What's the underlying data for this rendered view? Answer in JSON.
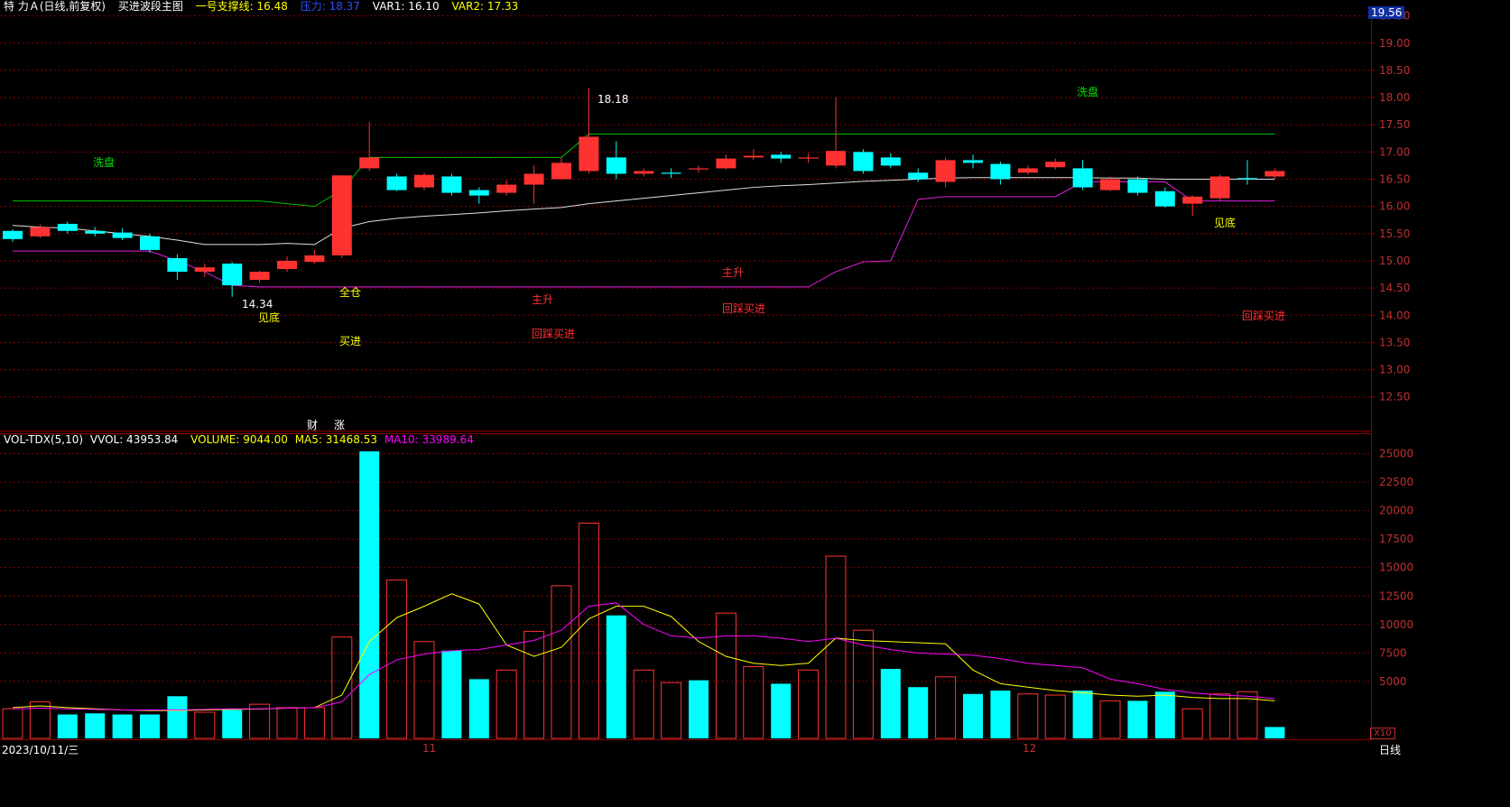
{
  "header": {
    "stock_name": "特 力Ａ(日线,前复权)",
    "indicator_name": "买进波段主图",
    "support_label": "一号支撑线: 16.48",
    "resistance_label": "压力: 18.37",
    "var1_label": "VAR1: 16.10",
    "var2_label": "VAR2: 17.33",
    "price_tag": "19.56"
  },
  "volume_header": {
    "name": "VOL-TDX(5,10)",
    "vvol": "VVOL: 43953.84",
    "volume": "VOLUME: 9044.00",
    "ma5": "MA5: 31468.53",
    "ma10": "MA10: 33989.64"
  },
  "footer": {
    "date": "2023/10/11/三",
    "month_nov": "11",
    "month_dec": "12",
    "period": "日线",
    "zoom": "X10"
  },
  "colors": {
    "up": "#ff3232",
    "down": "#00ffff",
    "volma5": "#ffff00",
    "volma10": "#ff00ff",
    "grid": "#8b0000",
    "support": "#00c000",
    "white_line": "#e0e0e0",
    "lower_band": "#e020e0"
  },
  "chart_data": [
    {
      "type": "candlestick",
      "title": "",
      "ylim": [
        12.0,
        19.56
      ],
      "yticks": [
        "19.50",
        "19.00",
        "18.50",
        "18.00",
        "17.50",
        "17.00",
        "16.50",
        "16.00",
        "15.50",
        "15.00",
        "14.50",
        "14.00",
        "13.50",
        "13.00",
        "12.50"
      ],
      "candles": [
        {
          "o": 15.55,
          "c": 15.4,
          "h": 15.58,
          "l": 15.35
        },
        {
          "o": 15.45,
          "c": 15.62,
          "h": 15.67,
          "l": 15.42
        },
        {
          "o": 15.68,
          "c": 15.55,
          "h": 15.72,
          "l": 15.5
        },
        {
          "o": 15.55,
          "c": 15.5,
          "h": 15.62,
          "l": 15.45
        },
        {
          "o": 15.52,
          "c": 15.42,
          "h": 15.6,
          "l": 15.38
        },
        {
          "o": 15.45,
          "c": 15.2,
          "h": 15.5,
          "l": 15.15
        },
        {
          "o": 15.05,
          "c": 14.8,
          "h": 15.12,
          "l": 14.65
        },
        {
          "o": 14.8,
          "c": 14.88,
          "h": 14.95,
          "l": 14.7
        },
        {
          "o": 14.95,
          "c": 14.55,
          "h": 14.98,
          "l": 14.34
        },
        {
          "o": 14.65,
          "c": 14.8,
          "h": 14.82,
          "l": 14.6
        },
        {
          "o": 14.85,
          "c": 15.0,
          "h": 15.08,
          "l": 14.8
        },
        {
          "o": 14.98,
          "c": 15.1,
          "h": 15.2,
          "l": 14.95
        },
        {
          "o": 15.1,
          "c": 16.57,
          "h": 16.57,
          "l": 15.05
        },
        {
          "o": 16.7,
          "c": 16.9,
          "h": 17.55,
          "l": 16.65
        },
        {
          "o": 16.55,
          "c": 16.3,
          "h": 16.6,
          "l": 16.28
        },
        {
          "o": 16.35,
          "c": 16.58,
          "h": 16.62,
          "l": 16.3
        },
        {
          "o": 16.55,
          "c": 16.25,
          "h": 16.6,
          "l": 16.2
        },
        {
          "o": 16.3,
          "c": 16.2,
          "h": 16.35,
          "l": 16.05
        },
        {
          "o": 16.25,
          "c": 16.4,
          "h": 16.48,
          "l": 16.2
        },
        {
          "o": 16.4,
          "c": 16.6,
          "h": 16.75,
          "l": 16.05
        },
        {
          "o": 16.5,
          "c": 16.8,
          "h": 16.9,
          "l": 16.5
        },
        {
          "o": 16.65,
          "c": 17.28,
          "h": 18.18,
          "l": 16.6
        },
        {
          "o": 16.9,
          "c": 16.6,
          "h": 17.2,
          "l": 16.5
        },
        {
          "o": 16.6,
          "c": 16.65,
          "h": 16.7,
          "l": 16.55
        },
        {
          "o": 16.62,
          "c": 16.6,
          "h": 16.7,
          "l": 16.52
        },
        {
          "o": 16.68,
          "c": 16.7,
          "h": 16.75,
          "l": 16.62
        },
        {
          "o": 16.7,
          "c": 16.88,
          "h": 16.95,
          "l": 16.68
        },
        {
          "o": 16.9,
          "c": 16.93,
          "h": 17.05,
          "l": 16.85
        },
        {
          "o": 16.95,
          "c": 16.88,
          "h": 17.0,
          "l": 16.8
        },
        {
          "o": 16.88,
          "c": 16.9,
          "h": 16.97,
          "l": 16.8
        },
        {
          "o": 16.75,
          "c": 17.02,
          "h": 18.0,
          "l": 16.7
        },
        {
          "o": 17.0,
          "c": 16.65,
          "h": 17.05,
          "l": 16.6
        },
        {
          "o": 16.9,
          "c": 16.75,
          "h": 16.98,
          "l": 16.7
        },
        {
          "o": 16.62,
          "c": 16.5,
          "h": 16.7,
          "l": 16.45
        },
        {
          "o": 16.45,
          "c": 16.85,
          "h": 16.9,
          "l": 16.35
        },
        {
          "o": 16.85,
          "c": 16.8,
          "h": 16.95,
          "l": 16.7
        },
        {
          "o": 16.78,
          "c": 16.5,
          "h": 16.82,
          "l": 16.4
        },
        {
          "o": 16.62,
          "c": 16.7,
          "h": 16.75,
          "l": 16.58
        },
        {
          "o": 16.72,
          "c": 16.82,
          "h": 16.88,
          "l": 16.68
        },
        {
          "o": 16.7,
          "c": 16.35,
          "h": 16.85,
          "l": 16.3
        },
        {
          "o": 16.3,
          "c": 16.5,
          "h": 16.55,
          "l": 16.28
        },
        {
          "o": 16.5,
          "c": 16.25,
          "h": 16.55,
          "l": 16.2
        },
        {
          "o": 16.28,
          "c": 16.0,
          "h": 16.35,
          "l": 15.98
        },
        {
          "o": 16.05,
          "c": 16.18,
          "h": 16.2,
          "l": 15.82
        },
        {
          "o": 16.15,
          "c": 16.55,
          "h": 16.58,
          "l": 16.1
        },
        {
          "o": 16.52,
          "c": 16.5,
          "h": 16.85,
          "l": 16.4
        },
        {
          "o": 16.55,
          "c": 16.65,
          "h": 16.7,
          "l": 16.5
        }
      ],
      "support_line": [
        16.1,
        16.1,
        16.1,
        16.1,
        16.1,
        16.1,
        16.1,
        16.1,
        16.1,
        16.1,
        16.05,
        16.0,
        16.3,
        16.9,
        16.9,
        16.9,
        16.9,
        16.9,
        16.9,
        16.9,
        16.9,
        17.33,
        17.33,
        17.33,
        17.33,
        17.33,
        17.33,
        17.33,
        17.33,
        17.33,
        17.33,
        17.33,
        17.33,
        17.33,
        17.33,
        17.33,
        17.33,
        17.33,
        17.33,
        17.33,
        17.33,
        17.33,
        17.33,
        17.33,
        17.33,
        17.33,
        17.33
      ],
      "lower_band": [
        15.18,
        15.18,
        15.18,
        15.18,
        15.18,
        15.18,
        15.0,
        14.8,
        14.55,
        14.52,
        14.52,
        14.52,
        14.52,
        14.52,
        14.52,
        14.52,
        14.52,
        14.52,
        14.52,
        14.52,
        14.52,
        14.52,
        14.52,
        14.52,
        14.52,
        14.52,
        14.52,
        14.52,
        14.52,
        14.52,
        14.8,
        14.98,
        15.0,
        16.13,
        16.18,
        16.18,
        16.18,
        16.18,
        16.18,
        16.45,
        16.45,
        16.45,
        16.45,
        16.1,
        16.1,
        16.1,
        16.1
      ],
      "white_line": [
        15.65,
        15.62,
        15.6,
        15.55,
        15.5,
        15.45,
        15.38,
        15.3,
        15.3,
        15.3,
        15.32,
        15.3,
        15.6,
        15.72,
        15.78,
        15.82,
        15.85,
        15.88,
        15.92,
        15.95,
        15.98,
        16.05,
        16.1,
        16.15,
        16.2,
        16.25,
        16.3,
        16.35,
        16.38,
        16.4,
        16.43,
        16.46,
        16.48,
        16.5,
        16.52,
        16.53,
        16.53,
        16.53,
        16.53,
        16.53,
        16.52,
        16.52,
        16.5,
        16.5,
        16.5,
        16.5,
        16.5
      ],
      "labels": [
        "洗盘",
        "见底",
        "买进",
        "全仓",
        "主升",
        "回踩买进",
        "主升",
        "回踩买进",
        "洗盘",
        "见底",
        "回踩买进",
        "财",
        "涨",
        "14.34",
        "18.18"
      ]
    },
    {
      "type": "bar",
      "title": "VOL-TDX(5,10)",
      "ylim": [
        0,
        26000
      ],
      "yticks": [
        "25000",
        "22500",
        "20000",
        "17500",
        "15000",
        "12500",
        "10000",
        "7500",
        "5000"
      ],
      "values": [
        2600,
        3200,
        2100,
        2200,
        2100,
        2100,
        3700,
        2300,
        2500,
        3000,
        2700,
        2700,
        8900,
        25200,
        13900,
        8500,
        7700,
        5200,
        6000,
        9400,
        13400,
        18900,
        10800,
        6000,
        4900,
        5100,
        11000,
        6300,
        4800,
        6000,
        16000,
        9500,
        6100,
        4500,
        5400,
        3900,
        4200,
        3900,
        3800,
        4200,
        3300,
        3300,
        4100,
        2600,
        3900,
        4100,
        1000
      ],
      "ma5": [
        2700,
        2850,
        2700,
        2600,
        2500,
        2450,
        2450,
        2500,
        2550,
        2580,
        2650,
        2700,
        3800,
        8500,
        10600,
        11600,
        12700,
        11800,
        8200,
        7200,
        8000,
        10500,
        11600,
        11600,
        10700,
        8500,
        7200,
        6600,
        6400,
        6600,
        8800,
        8600,
        8500,
        8400,
        8300,
        6000,
        4800,
        4500,
        4200,
        4000,
        3800,
        3700,
        3800,
        3600,
        3500,
        3500,
        3300
      ],
      "ma10": [
        2600,
        2650,
        2600,
        2550,
        2500,
        2500,
        2500,
        2550,
        2600,
        2600,
        2650,
        2700,
        3200,
        5600,
        6900,
        7400,
        7700,
        7800,
        8200,
        8600,
        9500,
        11600,
        11900,
        10000,
        9000,
        8800,
        9000,
        9000,
        8800,
        8500,
        8800,
        8200,
        7800,
        7500,
        7400,
        7300,
        7000,
        6600,
        6400,
        6200,
        5200,
        4800,
        4300,
        4000,
        3800,
        3700,
        3500
      ],
      "up_flags": [
        true,
        true,
        false,
        false,
        false,
        false,
        false,
        true,
        false,
        true,
        true,
        true,
        true,
        false,
        true,
        true,
        false,
        false,
        true,
        true,
        true,
        true,
        false,
        true,
        true,
        false,
        true,
        true,
        false,
        true,
        true,
        true,
        false,
        false,
        true,
        false,
        false,
        true,
        true,
        false,
        true,
        false,
        false,
        true,
        true,
        true,
        false
      ]
    }
  ]
}
